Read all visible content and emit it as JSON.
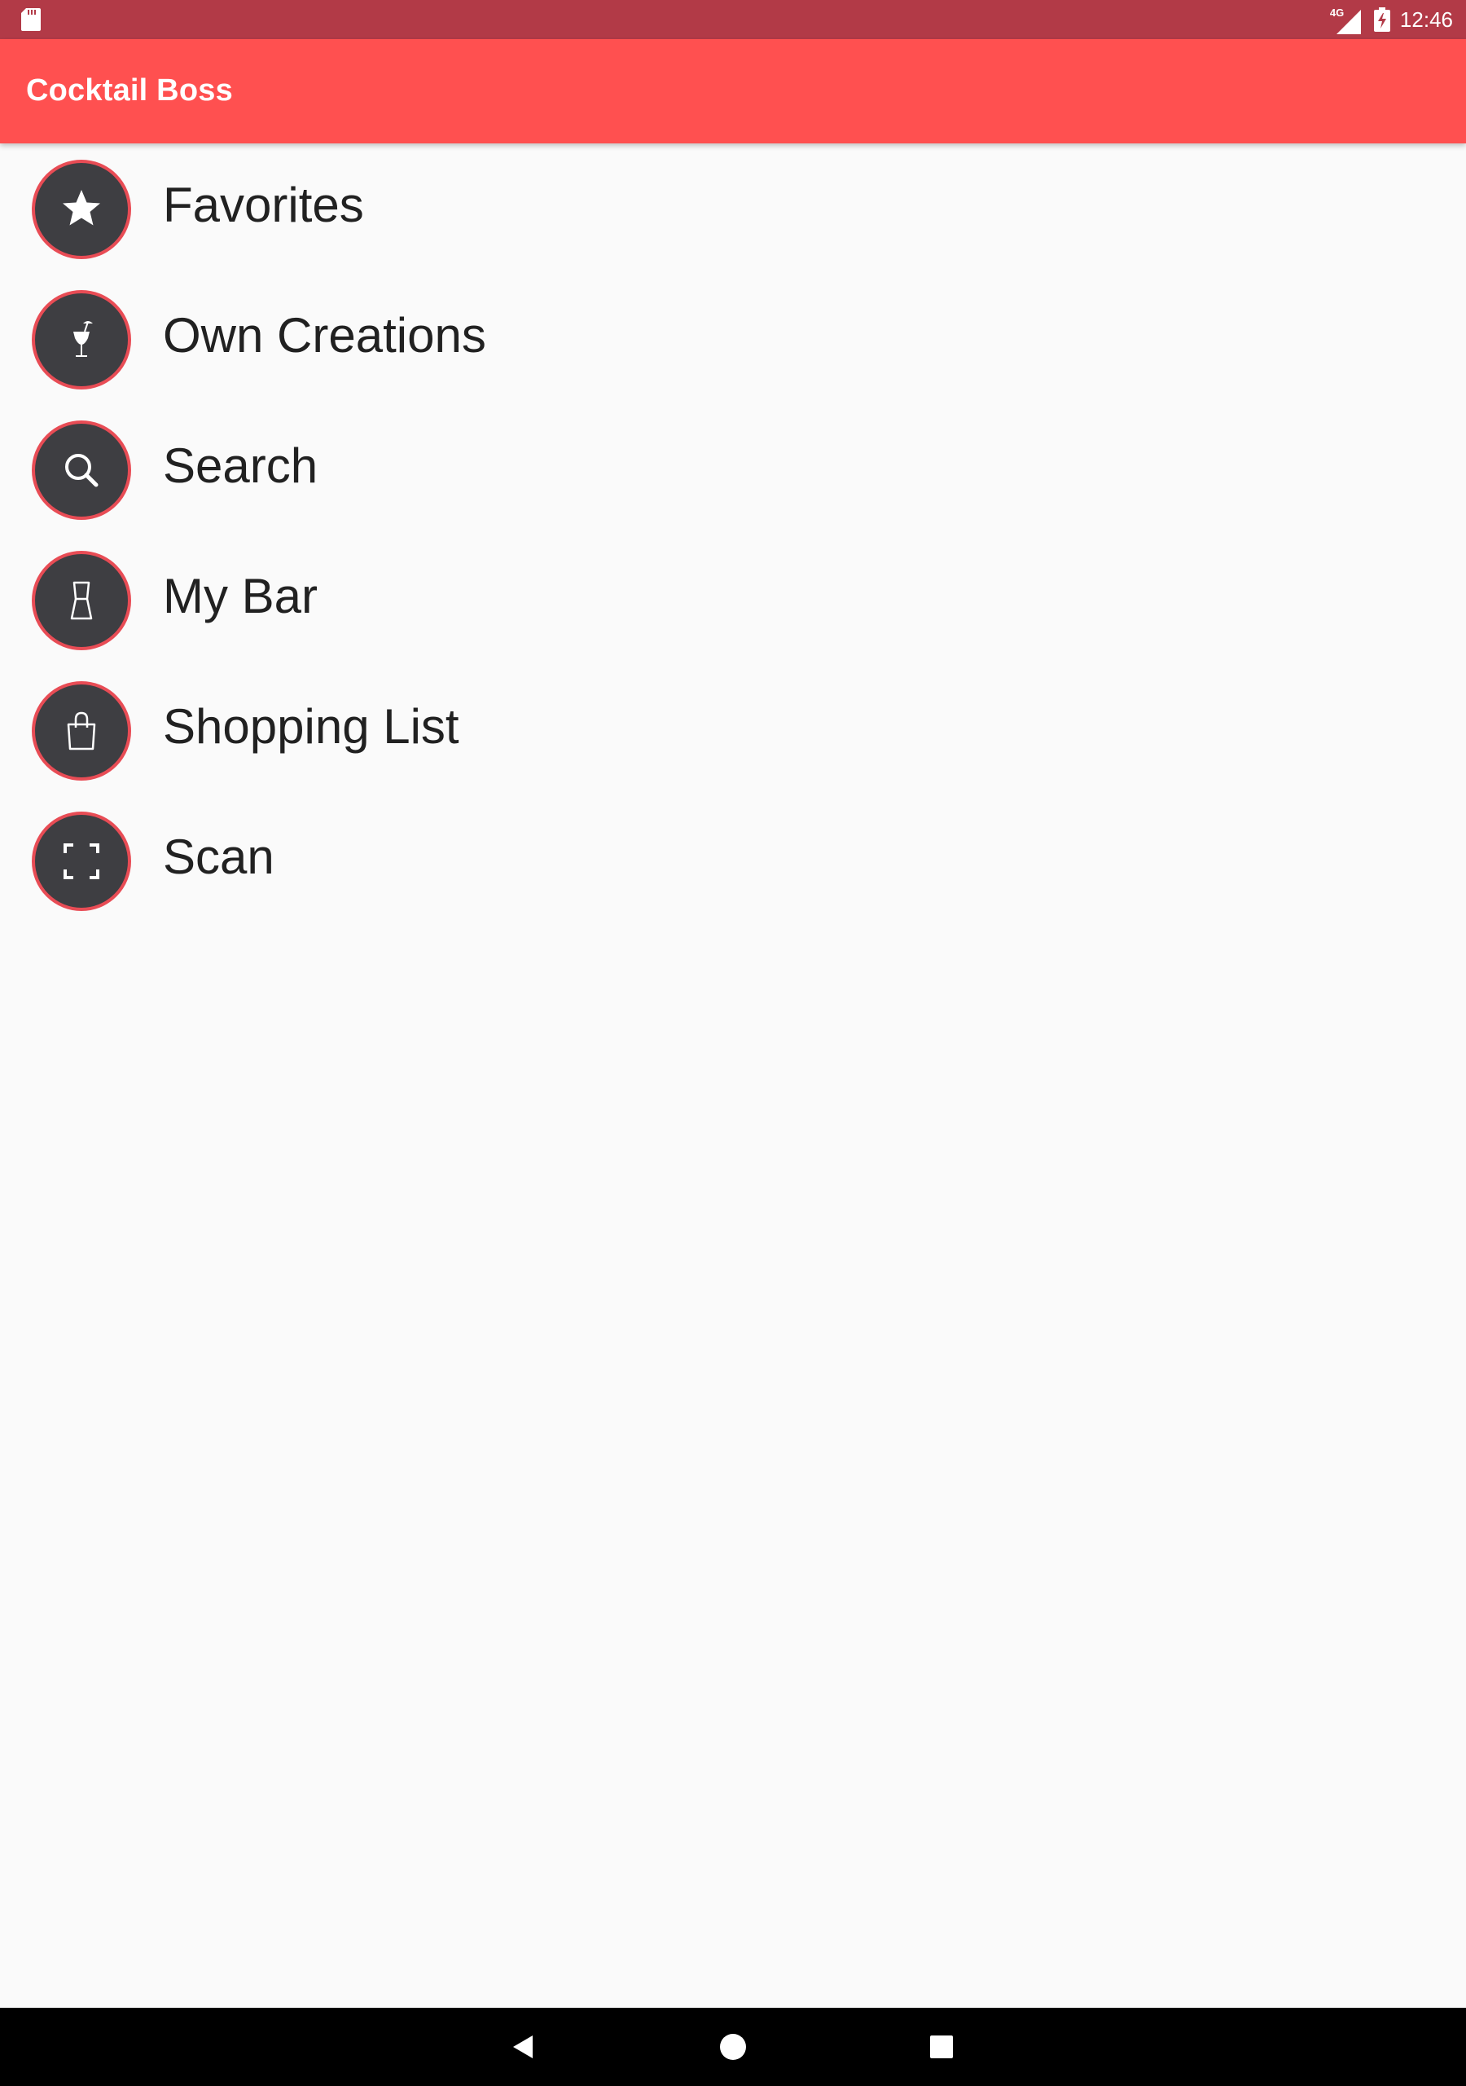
{
  "status_bar": {
    "network": "4G",
    "time": "12:46"
  },
  "app_bar": {
    "title": "Cocktail Boss"
  },
  "menu": {
    "items": [
      {
        "label": "Favorites",
        "icon": "star-icon"
      },
      {
        "label": "Own Creations",
        "icon": "cocktail-glass-icon"
      },
      {
        "label": "Search",
        "icon": "search-icon"
      },
      {
        "label": "My Bar",
        "icon": "glass-icon"
      },
      {
        "label": "Shopping List",
        "icon": "shopping-bag-icon"
      },
      {
        "label": "Scan",
        "icon": "scan-frame-icon"
      }
    ]
  },
  "colors": {
    "status_bar": "#b23a47",
    "app_bar": "#ff5050",
    "icon_background": "#3e3e42",
    "icon_ring": "#e84c55",
    "background": "#fafafa",
    "nav_bar": "#000000"
  },
  "nav_bar": {
    "buttons": [
      "back-icon",
      "home-icon",
      "recents-icon"
    ]
  }
}
